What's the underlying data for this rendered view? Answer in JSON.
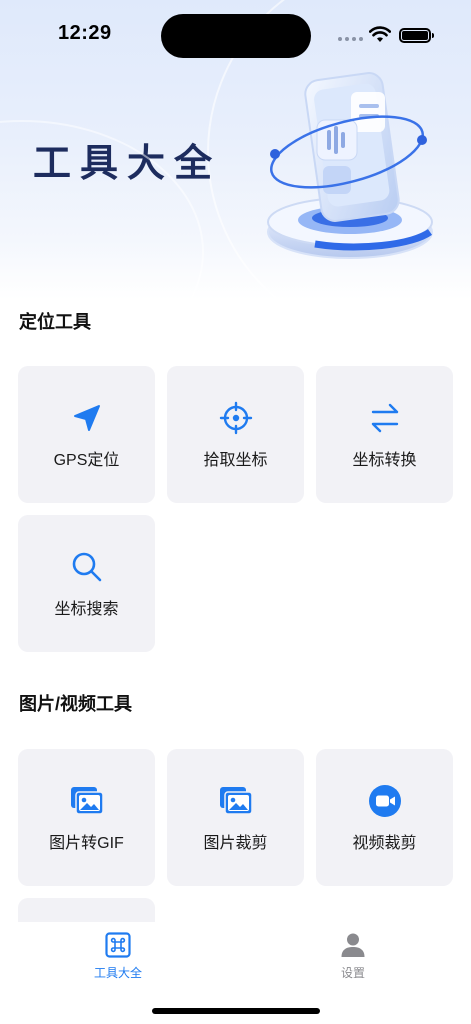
{
  "status_bar": {
    "time": "12:29"
  },
  "hero": {
    "title": "工具大全"
  },
  "sections": [
    {
      "title": "定位工具",
      "tools": [
        {
          "label": "GPS定位",
          "icon": "location-arrow-icon"
        },
        {
          "label": "拾取坐标",
          "icon": "crosshair-icon"
        },
        {
          "label": "坐标转换",
          "icon": "swap-arrows-icon"
        },
        {
          "label": "坐标搜索",
          "icon": "search-icon"
        }
      ]
    },
    {
      "title": "图片/视频工具",
      "tools": [
        {
          "label": "图片转GIF",
          "icon": "image-gallery-icon"
        },
        {
          "label": "图片裁剪",
          "icon": "image-gallery-icon"
        },
        {
          "label": "视频裁剪",
          "icon": "video-camera-icon"
        }
      ]
    }
  ],
  "tab_bar": {
    "tabs": [
      {
        "label": "工具大全",
        "icon": "command-key-icon",
        "active": true
      },
      {
        "label": "设置",
        "icon": "person-icon",
        "active": false
      }
    ]
  },
  "colors": {
    "accent": "#1f7bf0",
    "card_bg": "#f2f2f6",
    "hero_title": "#1d2c5e",
    "tab_inactive": "#8a8a8e"
  }
}
